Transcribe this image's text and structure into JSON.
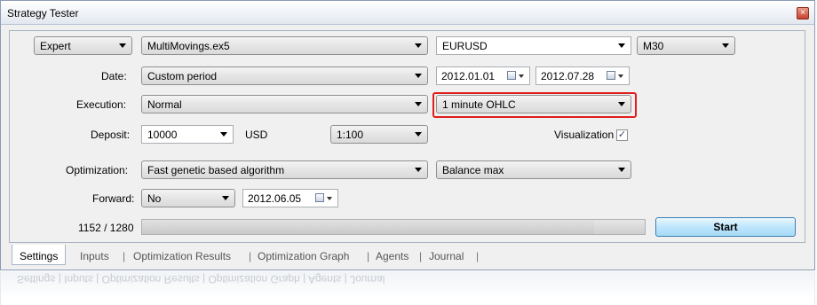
{
  "window": {
    "title": "Strategy Tester",
    "close_glyph": "×"
  },
  "settings": {
    "mode": "Expert",
    "expert_file": "MultiMovings.ex5",
    "symbol": "EURUSD",
    "timeframe": "M30",
    "date_label": "Date:",
    "date_mode": "Custom period",
    "date_from": "2012.01.01",
    "date_to": "2012.07.28",
    "execution_label": "Execution:",
    "execution": "Normal",
    "modelling": "1 minute OHLC",
    "deposit_label": "Deposit:",
    "deposit": "10000",
    "currency": "USD",
    "leverage": "1:100",
    "visualization_label": "Visualization",
    "visualization_checked": "✓",
    "optimization_label": "Optimization:",
    "optimization": "Fast genetic based algorithm",
    "criterion": "Balance max",
    "forward_label": "Forward:",
    "forward": "No",
    "forward_date": "2012.06.05"
  },
  "progress": {
    "text": "1152 / 1280",
    "fraction": 0.9
  },
  "start_label": "Start",
  "tabs": [
    "Settings",
    "Inputs",
    "Optimization Results",
    "Optimization Graph",
    "Agents",
    "Journal"
  ],
  "reflection_text": "Settings | Inputs | Optimization Results | Optimization Graph | Agents | Journal",
  "colors": {
    "highlight": "#e01e1e",
    "start_button": "#bee6fd"
  }
}
